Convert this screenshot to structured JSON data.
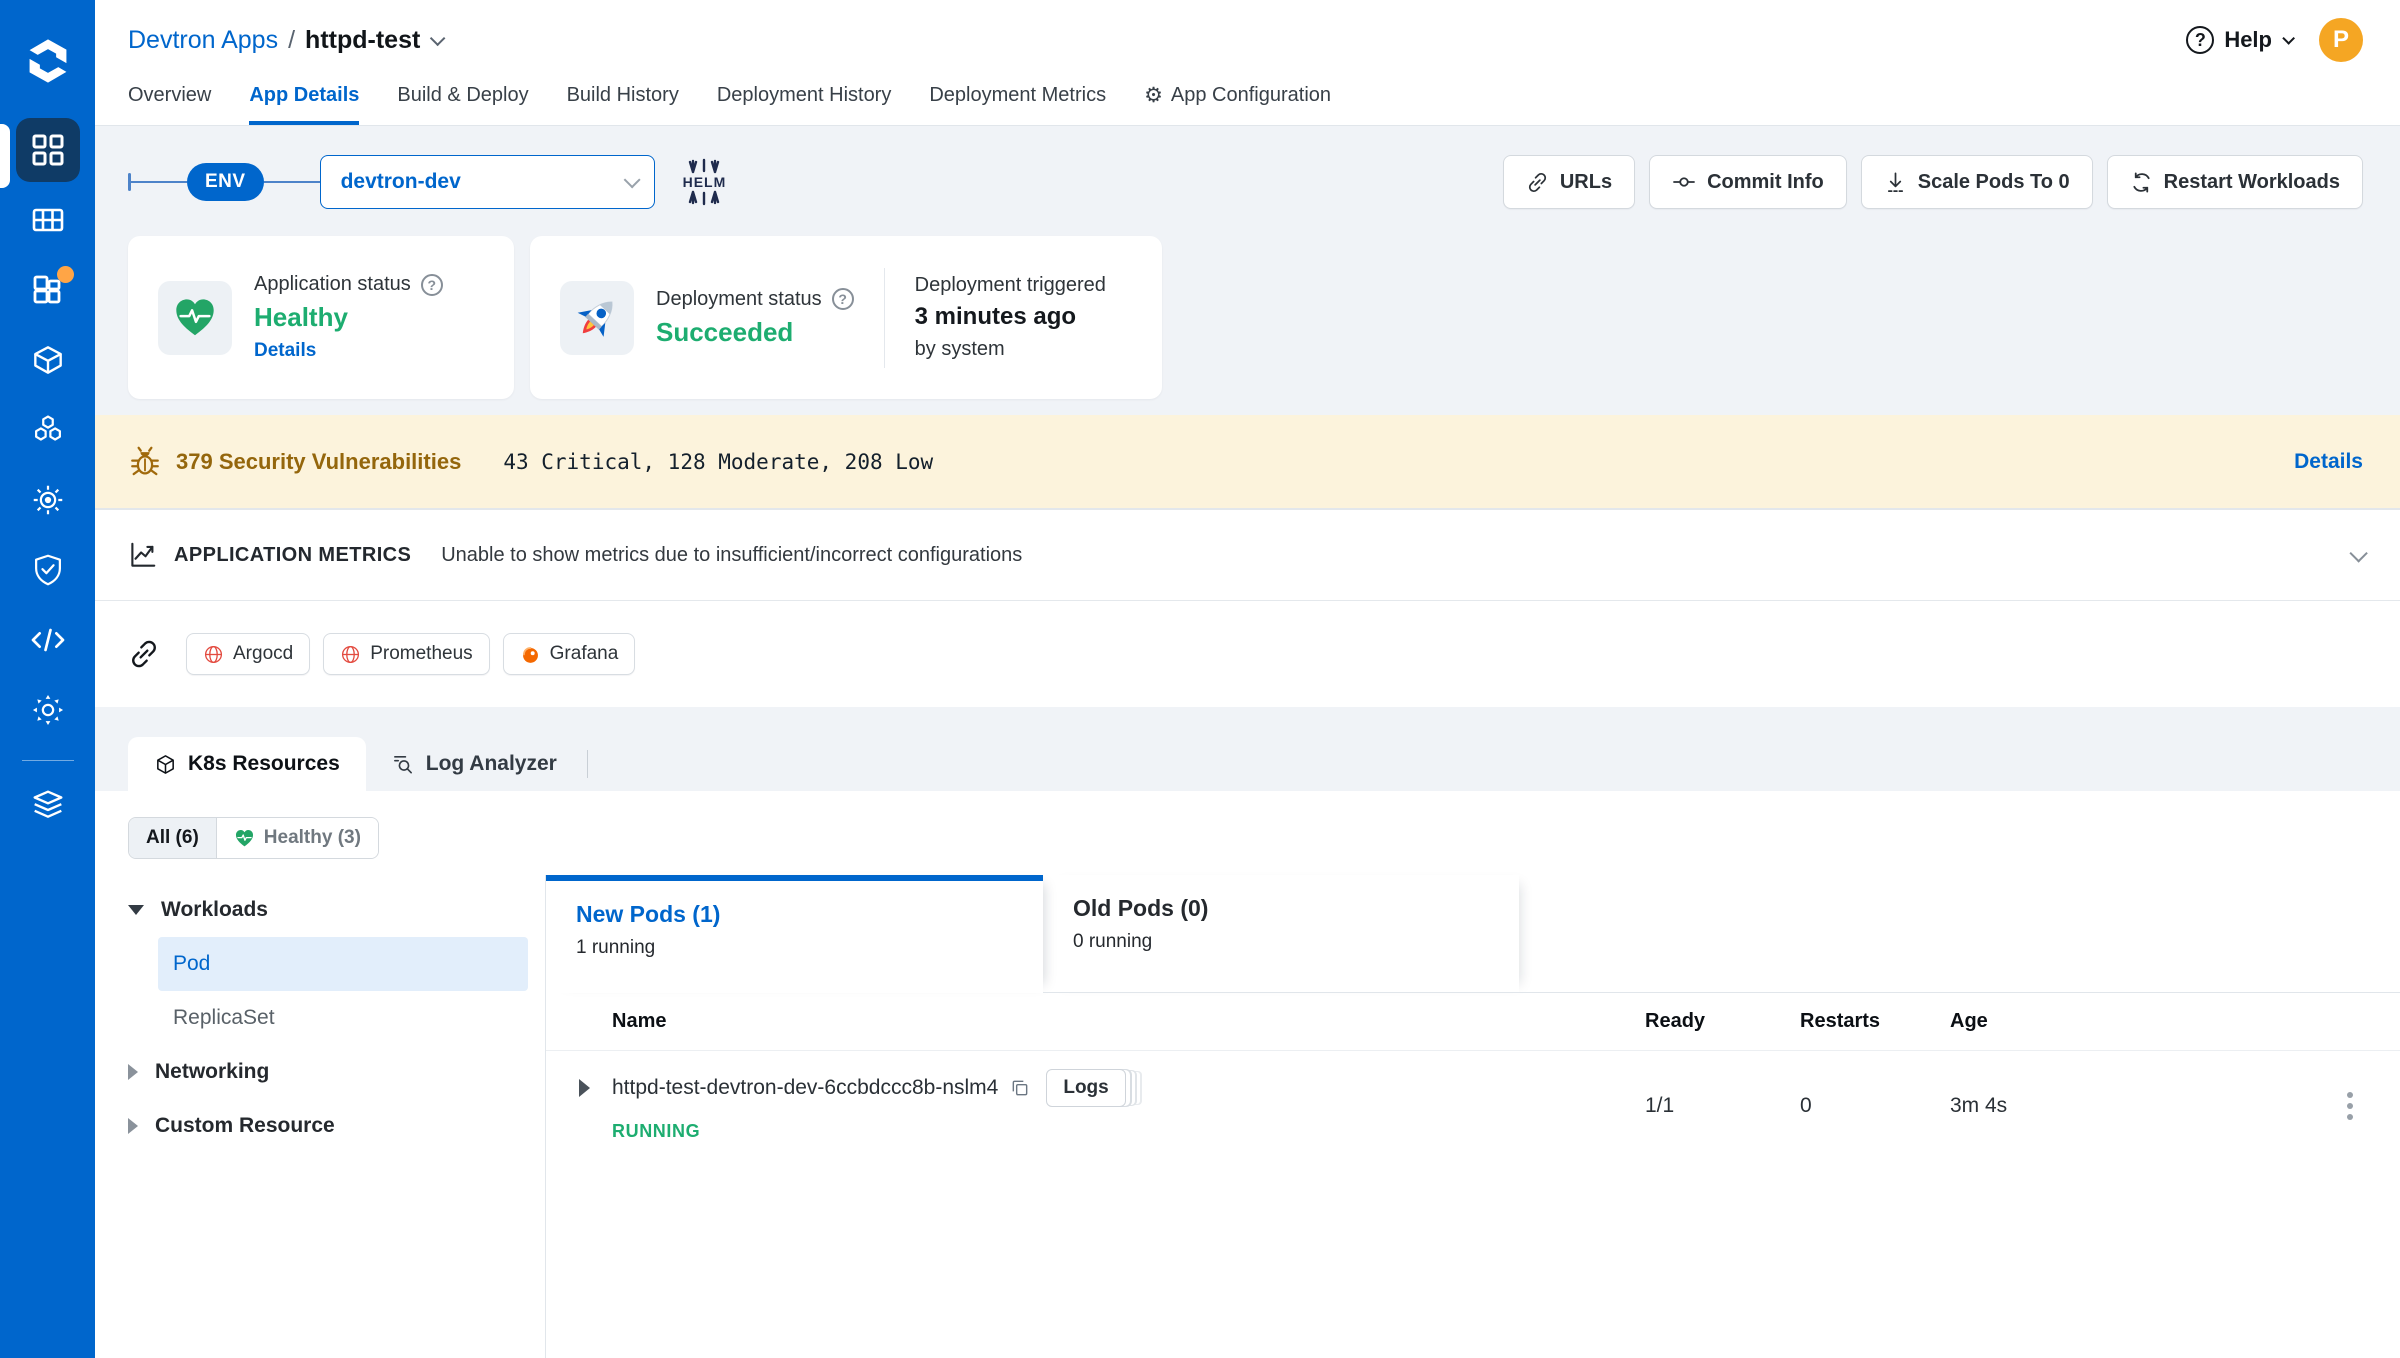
{
  "colors": {
    "accent": "#0066CC",
    "success": "#1DAD70",
    "warn_text": "#94660C",
    "banner_bg": "#FCF3DC",
    "sidebar": "#0066CC",
    "avatar_bg": "#F5A623"
  },
  "header": {
    "breadcrumb": {
      "root": "Devtron Apps",
      "separator": "/",
      "current": "httpd-test"
    },
    "help_label": "Help",
    "help_glyph": "?",
    "avatar_initial": "P",
    "tabs": [
      {
        "label": "Overview"
      },
      {
        "label": "App Details"
      },
      {
        "label": "Build & Deploy"
      },
      {
        "label": "Build History"
      },
      {
        "label": "Deployment History"
      },
      {
        "label": "Deployment Metrics"
      },
      {
        "label": "App Configuration"
      }
    ],
    "gear_glyph": "⚙"
  },
  "env_bar": {
    "env_label": "ENV",
    "selected_env": "devtron-dev",
    "helm_label": "HELM",
    "actions": [
      {
        "label": "URLs"
      },
      {
        "label": "Commit Info"
      },
      {
        "label": "Scale Pods To 0"
      },
      {
        "label": "Restart Workloads"
      }
    ]
  },
  "status_cards": {
    "application": {
      "title": "Application status",
      "help_glyph": "?",
      "value": "Healthy",
      "link": "Details"
    },
    "deployment": {
      "title": "Deployment status",
      "help_glyph": "?",
      "value": "Succeeded",
      "triggered_label": "Deployment triggered",
      "triggered_time": "3 minutes ago",
      "triggered_by": "by system"
    }
  },
  "security_banner": {
    "title": "379 Security Vulnerabilities",
    "summary": "43 Critical, 128 Moderate, 208 Low",
    "link": "Details"
  },
  "metrics": {
    "title": "APPLICATION METRICS",
    "message": "Unable to show metrics due to insufficient/incorrect configurations"
  },
  "external_links": [
    {
      "label": "Argocd"
    },
    {
      "label": "Prometheus"
    },
    {
      "label": "Grafana"
    }
  ],
  "resource_tabs": [
    {
      "label": "K8s Resources"
    },
    {
      "label": "Log Analyzer"
    }
  ],
  "filters": [
    {
      "label": "All (6)"
    },
    {
      "label": "Healthy (3)"
    }
  ],
  "tree": {
    "workloads": {
      "label": "Workloads",
      "children": [
        {
          "label": "Pod"
        },
        {
          "label": "ReplicaSet"
        }
      ]
    },
    "networking": {
      "label": "Networking"
    },
    "custom_resource": {
      "label": "Custom Resource"
    }
  },
  "pods": {
    "tabs": [
      {
        "title": "New Pods (1)",
        "subtitle": "1 running"
      },
      {
        "title": "Old Pods (0)",
        "subtitle": "0 running"
      }
    ],
    "columns": {
      "name": "Name",
      "ready": "Ready",
      "restarts": "Restarts",
      "age": "Age"
    },
    "rows": [
      {
        "name": "httpd-test-devtron-dev-6ccbdccc8b-nslm4",
        "logs_label": "Logs",
        "status": "RUNNING",
        "ready": "1/1",
        "restarts": "0",
        "age": "3m 4s"
      }
    ]
  }
}
